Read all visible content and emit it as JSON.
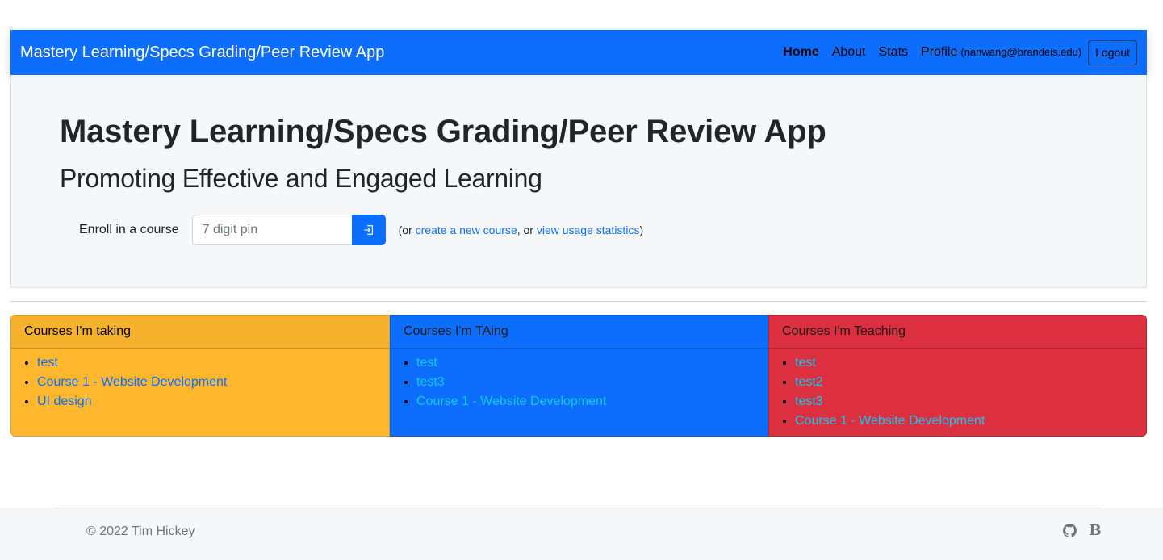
{
  "navbar": {
    "brand": "Mastery Learning/Specs Grading/Peer Review App",
    "links": {
      "home": "Home",
      "about": "About",
      "stats": "Stats",
      "profile": "Profile"
    },
    "user_email": "(nanwang@brandeis.edu)",
    "logout": "Logout",
    "bg_color": "#0d6efd"
  },
  "hero": {
    "title": "Mastery Learning/Specs Grading/Peer Review App",
    "subtitle": "Promoting Effective and Engaged Learning",
    "enroll_label": "Enroll in a course",
    "pin_placeholder": "7 digit pin",
    "enroll_button_icon": "box-arrow-in-right-icon",
    "note_prefix": "(or ",
    "create_course_link": "create a new course",
    "note_middle": ", or ",
    "usage_stats_link": "view usage statistics",
    "note_suffix": ")"
  },
  "cards": {
    "taking": {
      "title": "Courses I'm taking",
      "color": "#ffb82e",
      "items": [
        "test",
        "Course 1 - Website Development",
        "UI design"
      ]
    },
    "ta": {
      "title": "Courses I'm TAing",
      "color": "#0d6efd",
      "items": [
        "test",
        "test3",
        "Course 1 - Website Development"
      ]
    },
    "teaching": {
      "title": "Courses I'm Teaching",
      "color": "#dc2f3f",
      "items": [
        "test",
        "test2",
        "test3",
        "Course 1 - Website Development"
      ]
    }
  },
  "footer": {
    "copyright": "© 2022 Tim Hickey",
    "icons": [
      "github-icon",
      "bootstrap-icon"
    ]
  }
}
